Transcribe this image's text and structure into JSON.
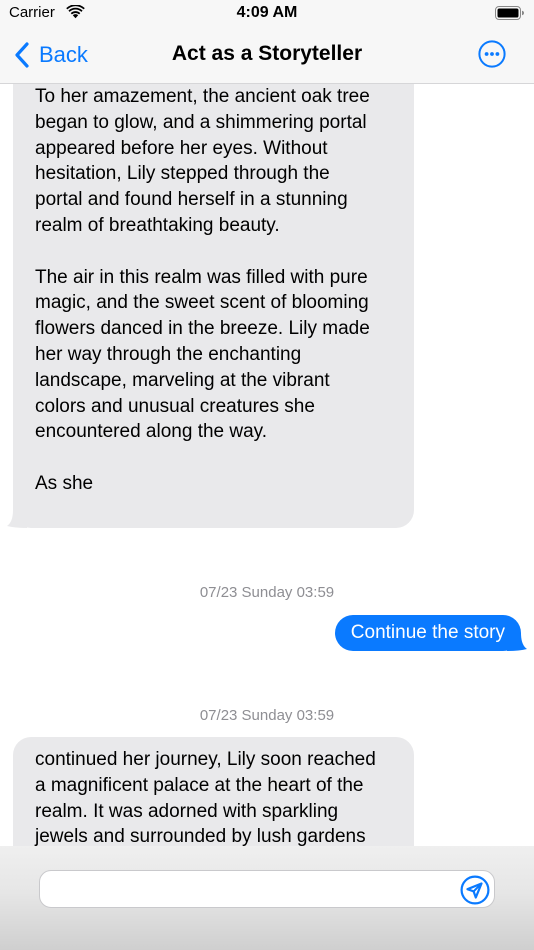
{
  "status_bar": {
    "carrier": "Carrier",
    "time": "4:09 AM"
  },
  "nav": {
    "back_label": "Back",
    "title": "Act as a Storyteller",
    "more_icon": "ellipsis-circle-icon"
  },
  "messages": [
    {
      "role": "assistant",
      "paragraphs": [
        "To her amazement, the ancient oak tree\nbegan to glow, and a shimmering portal\nappeared before her eyes. Without\nhesitation, Lily stepped through the\nportal and found herself in a stunning\nrealm of breathtaking beauty.",
        "The air in this realm was filled with pure\nmagic, and the sweet scent of blooming\nflowers danced in the breeze. Lily made\nher way through the enchanting\nlandscape, marveling at the vibrant\ncolors and unusual creatures she\nencountered along the way.",
        "As she"
      ]
    },
    {
      "role": "timestamp",
      "text": "07/23 Sunday 03:59"
    },
    {
      "role": "user",
      "text": "Continue the story"
    },
    {
      "role": "timestamp",
      "text": "07/23 Sunday 03:59"
    },
    {
      "role": "assistant",
      "text": "continued her journey, Lily soon reached\na magnificent palace at the heart of the\nrealm. It was adorned with sparkling\njewels and surrounded by lush gardens"
    }
  ],
  "input": {
    "value": "",
    "placeholder": ""
  },
  "colors": {
    "accent": "#0a7aff",
    "incoming_bubble": "#e9e9eb",
    "timestamp": "#8e8e93"
  }
}
